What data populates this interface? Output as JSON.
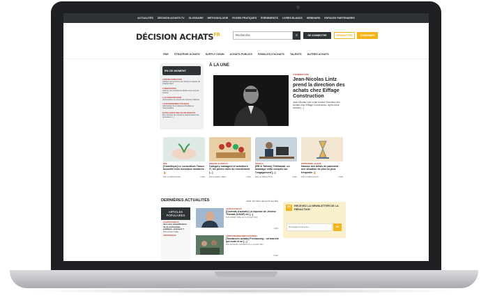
{
  "topbar": [
    "ACTUALITÉS",
    "DÉCISION ACHATS TV",
    "GLOSSAIRE",
    "MÉTHODOLOGIE",
    "FICHES PRATIQUES",
    "ÉVÉNEMENTS",
    "LIVRES BLANCS",
    "WEBINARS",
    "ESPACES PARTENAIRES"
  ],
  "header": {
    "logo": "DÉCISION ACHATS",
    "logo_suffix": "FR",
    "search_placeholder": "Recherche",
    "connect": "SE CONNECTER",
    "newsletter": "NEWSLETTER",
    "subscribe": "S'ABONNER"
  },
  "nav": [
    "RSE",
    "STRATÉGIE ACHATS",
    "SUPPLY CHAIN",
    "ACHATS PUBLICS",
    "FAMILLES D'ACHATS",
    "TALENTS",
    "AUTRES ACHATS"
  ],
  "moment": {
    "title": "EN CE MOMENT",
    "items": [
      {
        "cat": "# RÉORGANISATION",
        "text": "Adapter ses services aux besoins uniques de chaque client"
      },
      {
        "cat": "# INNOVATION",
        "text": "Assurer une expérience fluide entre tous les canaux"
      },
      {
        "cat": "# AUTOMATISATION",
        "text": "Optimisation du service de l'Achats Citalinas"
      },
      {
        "cat": "# RAISONNEMENT ÉTHIQUE",
        "text": "Valorisation des pratiques durables et responsables"
      },
      {
        "cat": "EXCELLENCE RELAIS DE ROBOTS",
        "text": "Des services de conseil et d'optimisation de processus [...]"
      }
    ]
  },
  "une": {
    "section": "À LA UNE",
    "cat": "# NOMINATIONS",
    "title": "Jean-Nicolas Lintz prend la direction des achats chez Eiffage Construction",
    "body": "Jean-Nicolas Lintz a été nommé Directeur des Achats chez Eiffage Construction, après avoir occupé [...]"
  },
  "cards": [
    {
      "cat": "RSE",
      "title": "[Cométique] Le consortium Trasce accueille trois nouveaux membres 🔒",
      "by": "PAR LA RÉDACTION",
      "rt": "3 MIN"
    },
    {
      "cat": "RISQUES & PROFILS",
      "title": "Category managers et acheteurs IT, les perles rares du recrutement [...]",
      "by": "PAR AUDREY FIBEL",
      "rt": "4 MIN"
    },
    {
      "cat": "PROFILS",
      "title": "[RH & Talents] Télétravail, un avantage enfin compris sur l'engagement [...]",
      "by": "PAR LA RÉDACTION",
      "rt": "5 MIN"
    },
    {
      "cat": "ENTREPRISE ACHATS",
      "title": "Hausse des délais de paiement : une situation de plus en plus fréquente 🔒",
      "by": "PAR LA RÉDACTION",
      "rt": "3 MIN"
    }
  ],
  "latest": {
    "title": "DERNIÈRES ACTUALITÉS",
    "see_all": "VOIR TOUTES LES ACTUALITÉS",
    "articles": [
      {
        "cat": "ACHATS PUBLICS",
        "title": "[Contrats d'achats] La réponse de Jérôme Thomas (UGAP) en [...]",
        "by": "PAR AUDREY FIBEL LE 12 JUILLET 2023",
        "rt": "4 MIN"
      },
      {
        "cat": "APPROVISIONNE-MENTS MATERIEL",
        "title": "[Tendances achats] Freelancing : un marché qui mute et se [...]",
        "by": "PAR GEOFFREY FROMENT LE 11 JUILLET 2023",
        "rt": "5 MIN"
      }
    ]
  },
  "popular": {
    "title": "ARTICLES POPULAIRES",
    "items": [
      {
        "cat": "ACHATS PUBLICS",
        "text": "Vers une simplification de la commande publique, vraiment ?",
        "by": "PAR AUDREY FIBEL"
      },
      {
        "cat": "STRATÉGIQUE",
        "text": "",
        "by": ""
      }
    ]
  },
  "newsletter": {
    "text": "RECEVEZ LA NEWSLETTER DE LA RÉDACTION",
    "placeholder": "florasp@reinetbgroup",
    "btn": "OK"
  }
}
